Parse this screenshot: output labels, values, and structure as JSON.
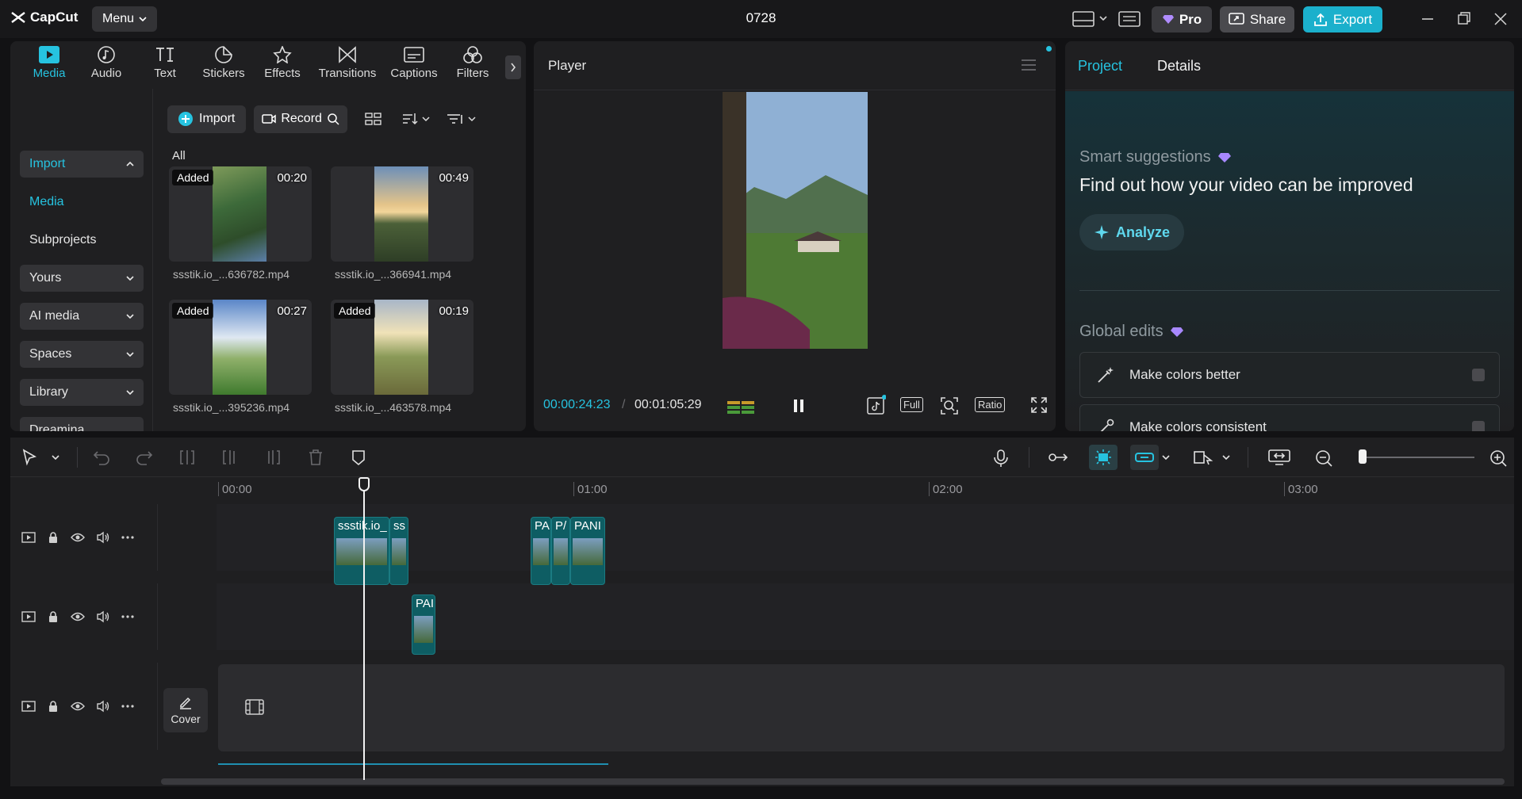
{
  "app": {
    "logo_text": "CapCut",
    "menu_label": "Menu",
    "project_title": "0728",
    "pro_label": "Pro",
    "share_label": "Share",
    "export_label": "Export"
  },
  "toolbar_tabs": [
    {
      "label": "Media",
      "icon": "media-icon",
      "active": true
    },
    {
      "label": "Audio",
      "icon": "audio-icon"
    },
    {
      "label": "Text",
      "icon": "text-icon"
    },
    {
      "label": "Stickers",
      "icon": "stickers-icon"
    },
    {
      "label": "Effects",
      "icon": "effects-icon"
    },
    {
      "label": "Transitions",
      "icon": "transitions-icon"
    },
    {
      "label": "Captions",
      "icon": "captions-icon"
    },
    {
      "label": "Filters",
      "icon": "filters-icon"
    }
  ],
  "media_sidebar": [
    {
      "label": "Import"
    },
    {
      "label": "Media"
    },
    {
      "label": "Subprojects"
    },
    {
      "label": "Yours"
    },
    {
      "label": "AI media"
    },
    {
      "label": "Spaces"
    },
    {
      "label": "Library"
    },
    {
      "label": "Dreamina"
    }
  ],
  "media_toolbar": {
    "import_label": "Import",
    "record_label": "Record"
  },
  "media_filter_label": "All",
  "media_items": [
    {
      "name": "ssstik.io_...636782.mp4",
      "duration": "00:20",
      "badge": "Added"
    },
    {
      "name": "ssstik.io_...366941.mp4",
      "duration": "00:49",
      "badge": ""
    },
    {
      "name": "ssstik.io_...395236.mp4",
      "duration": "00:27",
      "badge": "Added"
    },
    {
      "name": "ssstik.io_...463578.mp4",
      "duration": "00:19",
      "badge": "Added"
    }
  ],
  "player": {
    "title": "Player",
    "current_time": "00:00:24:23",
    "separator": "/",
    "total_time": "00:01:05:29",
    "full_label": "Full",
    "ratio_label": "Ratio"
  },
  "right_panel": {
    "tab_project": "Project",
    "tab_details": "Details",
    "smart_label": "Smart suggestions",
    "smart_title": "Find out how your video can be improved",
    "analyze_label": "Analyze",
    "global_label": "Global edits",
    "edits": [
      {
        "label": "Make colors better"
      },
      {
        "label": "Make colors consistent"
      }
    ]
  },
  "timeline": {
    "ruler": [
      "00:00",
      "01:00",
      "02:00",
      "03:00"
    ],
    "clips_track1": [
      "ssstik.io_",
      "ss",
      "PA",
      "P/",
      "PANI"
    ],
    "clips_track2": [
      "PAI"
    ],
    "cover_label": "Cover"
  },
  "colors": {
    "accent": "#26c3e0",
    "export": "#1bb0cc",
    "clip": "#0e5d63"
  }
}
